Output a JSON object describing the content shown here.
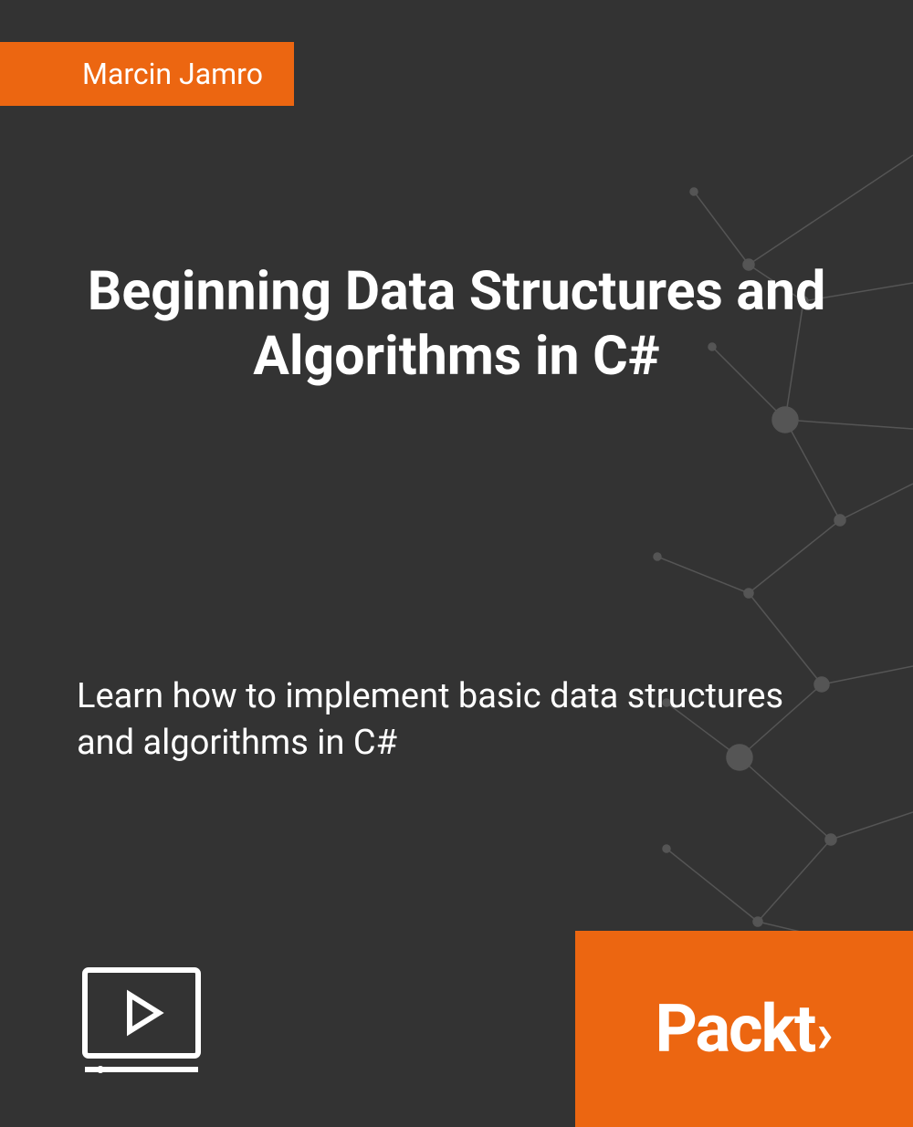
{
  "author": "Marcin Jamro",
  "title": "Beginning Data Structures and Algorithms in C#",
  "subtitle": "Learn how to implement basic data structures and algorithms in C#",
  "publisher": "Packt",
  "publisherSymbol": "›",
  "colors": {
    "background": "#333333",
    "accent": "#ec6611",
    "text": "#ffffff"
  }
}
